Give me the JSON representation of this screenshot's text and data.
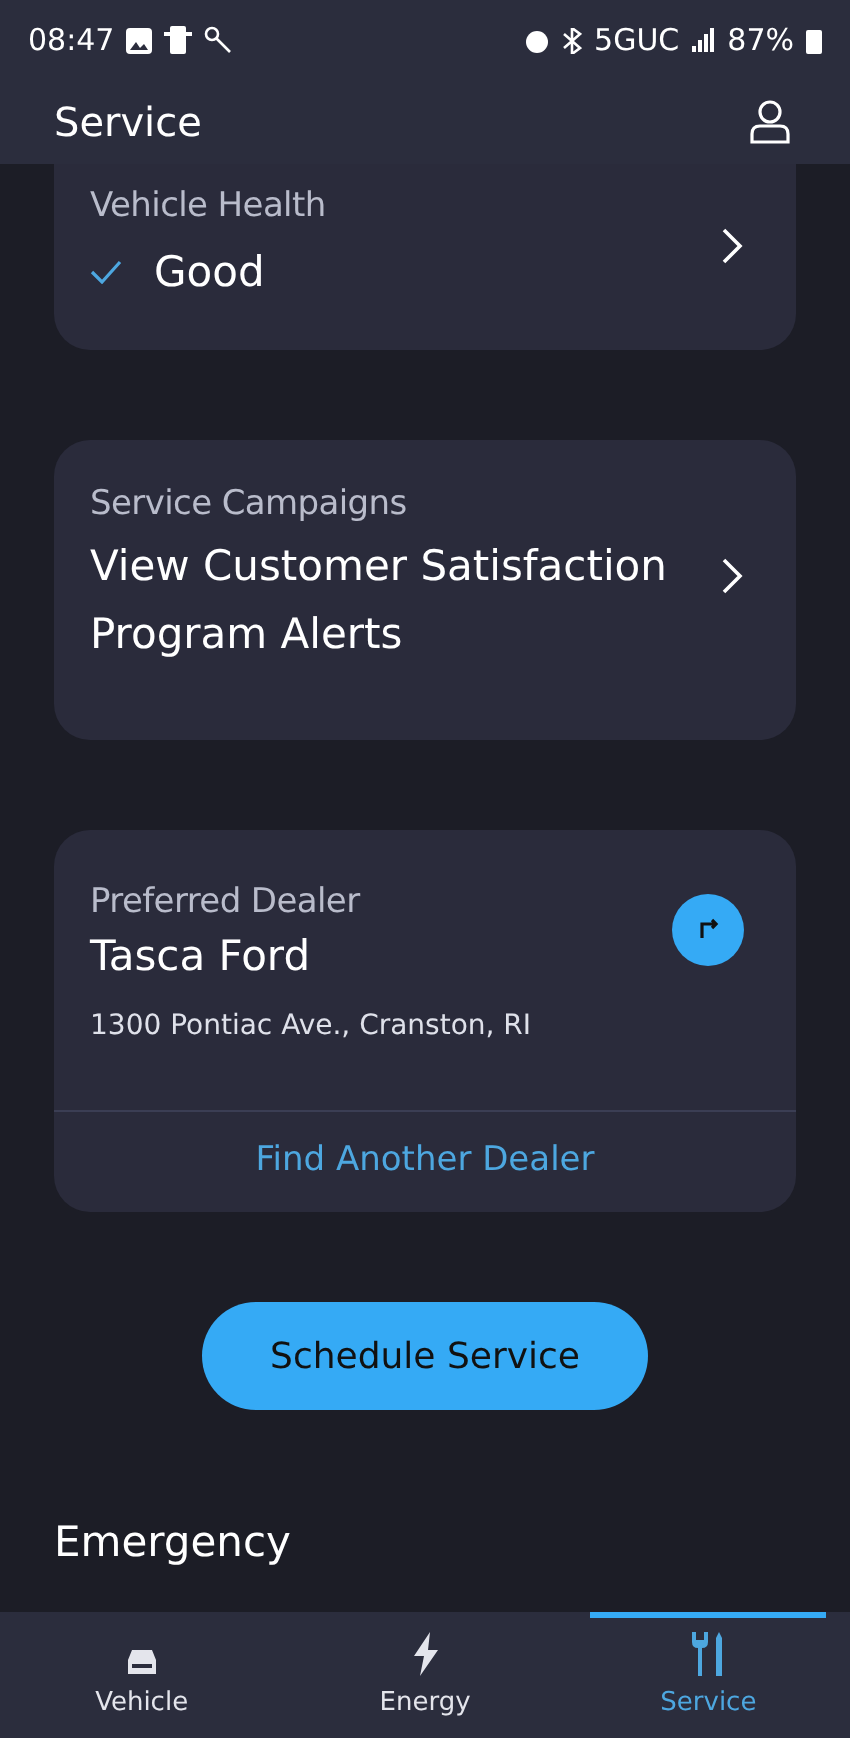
{
  "status_bar": {
    "time": "08:47",
    "network": "5GUC",
    "battery": "87%"
  },
  "header": {
    "title": "Service"
  },
  "vehicle_health": {
    "label": "Vehicle Health",
    "status": "Good"
  },
  "service_campaigns": {
    "label": "Service Campaigns",
    "text": "View Customer Satisfaction Program Alerts"
  },
  "preferred_dealer": {
    "label": "Preferred Dealer",
    "name": "Tasca Ford",
    "address": "1300 Pontiac Ave., Cranston, RI",
    "link": "Find Another Dealer"
  },
  "schedule_button": "Schedule Service",
  "section_title": "Emergency",
  "tabs": [
    {
      "kind": "vehicle",
      "label": "Vehicle",
      "selected": false
    },
    {
      "kind": "energy",
      "label": "Energy",
      "selected": false
    },
    {
      "kind": "service",
      "label": "Service",
      "selected": true
    }
  ]
}
